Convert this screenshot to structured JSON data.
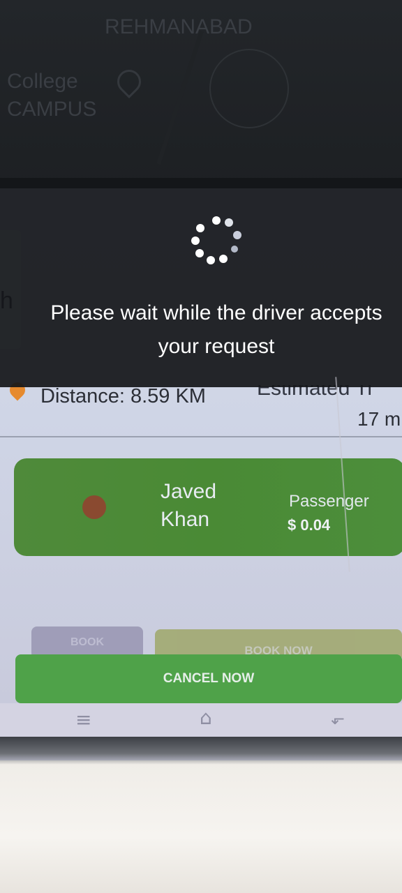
{
  "map": {
    "area_top": "REHMANABAD",
    "area_left_1": "College",
    "area_left_2": "CAMPUS"
  },
  "left_card": {
    "text": "h"
  },
  "loading": {
    "message": "Please wait while the driver accepts your request"
  },
  "trip": {
    "distance": "Distance: 8.59 KM",
    "estimated_label": "Estimated Ti",
    "estimated_value": "17 m"
  },
  "driver": {
    "name": "Javed Khan",
    "role": "Passenger",
    "fare": "$ 0.04"
  },
  "buttons": {
    "book": "BOOK",
    "book_now": "BOOK NOW",
    "cancel_now": "CANCEL NOW"
  },
  "navbar": {
    "menu_icon": "menu-icon",
    "home_icon": "home-icon",
    "back_icon": "back-icon"
  },
  "colors": {
    "driver_card": "#4a8a35",
    "cancel_button": "#4fa249",
    "pin": "#e68a2e",
    "overlay": "#141619"
  }
}
